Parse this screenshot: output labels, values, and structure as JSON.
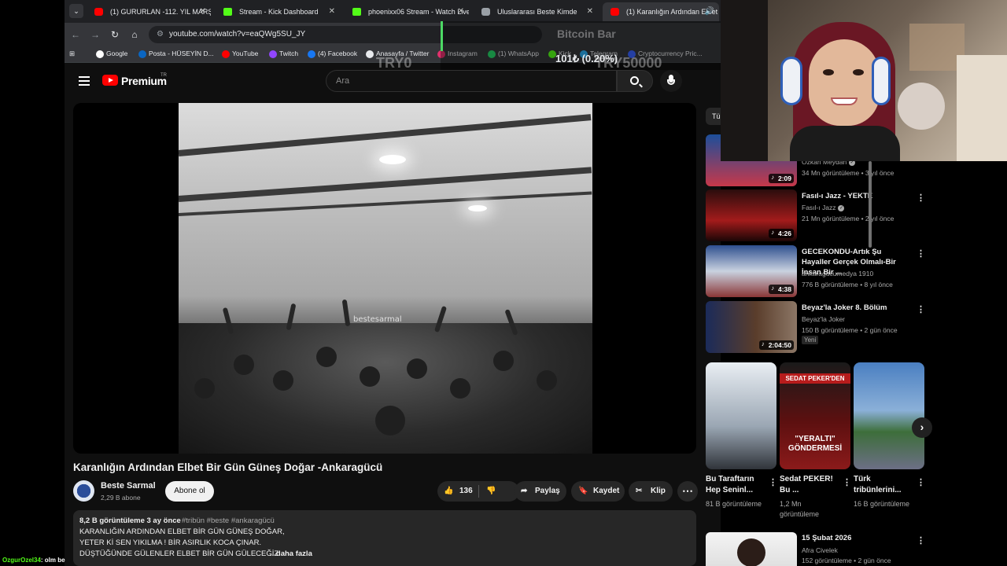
{
  "browser": {
    "tabs": [
      {
        "label": "(1) GURURLAN -112. YIL MARŞ",
        "icon": "youtube"
      },
      {
        "label": "Stream - Kick Dashboard",
        "icon": "kick"
      },
      {
        "label": "phoenixx06 Stream - Watch Live",
        "icon": "kick"
      },
      {
        "label": "Uluslararası Beste Kimde",
        "icon": "generic"
      },
      {
        "label": "(1) Karanlığın Ardından Elbet",
        "icon": "youtube"
      }
    ],
    "url": "youtube.com/watch?v=eaQWg5SU_JY",
    "bookmarks": [
      {
        "label": "Google",
        "color": "#ffffff"
      },
      {
        "label": "Posta - HÜSEYİN D...",
        "color": "#0a66c2"
      },
      {
        "label": "YouTube",
        "color": "#ff0000"
      },
      {
        "label": "Twitch",
        "color": "#9146ff"
      },
      {
        "label": "(4) Facebook",
        "color": "#1877f2"
      },
      {
        "label": "Anasayfa / Twitter",
        "color": "#e8eaed"
      },
      {
        "label": "Instagram",
        "color": "#e1306c"
      },
      {
        "label": "(1) WhatsApp",
        "color": "#25d366"
      },
      {
        "label": "Kick",
        "color": "#53fc18"
      },
      {
        "label": "Telegram",
        "color": "#2aabee"
      },
      {
        "label": "Cryptocurrency Pric...",
        "color": "#3861fb"
      }
    ]
  },
  "overlay": {
    "title": "Bitcoin Bar",
    "amount": "101₺ (0.20%)",
    "min_label": "TRY0",
    "max_label": "TRY50000"
  },
  "youtube": {
    "brand": "Premium",
    "region": "TR",
    "search_placeholder": "Ara",
    "video": {
      "watermark": "bestesarmal",
      "title": "Karanlığın Ardından Elbet Bir Gün Güneş Doğar -Ankaragücü",
      "channel": "Beste Sarmal",
      "subscribers": "2,29 B abone",
      "subscribe_label": "Abone ol",
      "likes": "136",
      "share_label": "Paylaş",
      "save_label": "Kaydet",
      "clip_label": "Klip",
      "description": {
        "meta": "8,2 B görüntüleme  3 ay önce",
        "tags": "#tribün #beste #ankaragücü",
        "lines": [
          "KARANLIĞIN ARDINDAN ELBET BİR GÜN GÜNEŞ DOĞAR,",
          "YETER Kİ SEN YIKILMA ! BİR ASIRLIK KOCA ÇINAR.",
          "DÜŞTÜĞÜNDE GÜLENLER ELBET BİR GÜN GÜLECEĞİZ."
        ],
        "more": "...daha fazla"
      }
    },
    "chip_partial": "Tü",
    "recommendations": [
      {
        "title": "",
        "channel": "Özkan Meydan",
        "stats": "34 Mn görüntüleme • 3 yıl önce",
        "duration": "2:09"
      },
      {
        "title": "Fasıl-ı Jazz - YEKTE",
        "channel": "Fasıl-ı Jazz",
        "stats": "21 Mn görüntüleme • 2 yıl önce",
        "duration": "4:26"
      },
      {
        "title": "GECEKONDU-Artık Şu Hayaller Gerçek Olmalı-Bir İnsan Bir ...",
        "channel": "ankaragucumedya 1910",
        "stats": "776 B görüntüleme • 8 yıl önce",
        "duration": "4:38"
      },
      {
        "title": "Beyaz'la Joker 8. Bölüm",
        "channel": "Beyaz'la Joker",
        "stats": "150 B görüntüleme • 2 gün önce",
        "duration": "2:04:50",
        "badge": "Yeni"
      }
    ],
    "shorts": [
      {
        "title": "Bu Taraftarın Hep Seninl...",
        "views": "81 B görüntüleme"
      },
      {
        "title": "Sedat PEKER! Bu ...",
        "views": "1,2 Mn görüntüleme",
        "thumb_text_top": "SEDAT PEKER'DEN",
        "thumb_text_bottom": "\"YERALTI\" GÖNDERMESİ"
      },
      {
        "title": "Türk tribünlerini...",
        "views": "16 B görüntüleme"
      }
    ],
    "bottom_reco": {
      "title": "15 Şubat 2026",
      "channel": "Afra Civelek",
      "stats": "152 görüntüleme • 2 gün önce"
    }
  },
  "chat": {
    "user": "OzgurOzel34",
    "text": ": olm be"
  }
}
